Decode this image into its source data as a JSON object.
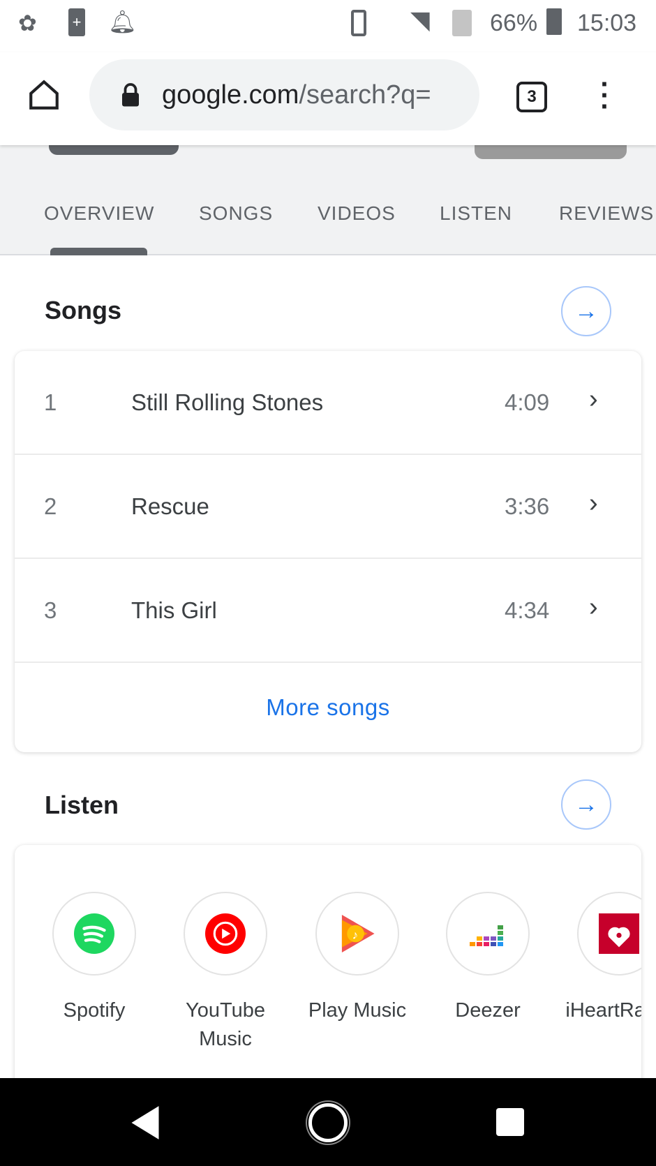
{
  "status_bar": {
    "battery": "66%",
    "time": "15:03",
    "icons": [
      "tree-icon",
      "battery-saver-icon",
      "bell-icon",
      "vibrate-icon",
      "wifi-icon",
      "no-sim-icon",
      "battery-icon"
    ]
  },
  "browser": {
    "url_domain": "google.com",
    "url_path": "/search?q=",
    "tab_count": "3"
  },
  "tabs": [
    {
      "label": "OVERVIEW",
      "active": true
    },
    {
      "label": "SONGS"
    },
    {
      "label": "VIDEOS"
    },
    {
      "label": "LISTEN"
    },
    {
      "label": "REVIEWS"
    }
  ],
  "songs": {
    "title": "Songs",
    "items": [
      {
        "num": "1",
        "title": "Still Rolling Stones",
        "duration": "4:09"
      },
      {
        "num": "2",
        "title": "Rescue",
        "duration": "3:36"
      },
      {
        "num": "3",
        "title": "This Girl",
        "duration": "4:34"
      }
    ],
    "more_label": "More songs"
  },
  "listen": {
    "title": "Listen",
    "services": [
      {
        "name": "Spotify",
        "color": "#1ed760"
      },
      {
        "name": "YouTube Music",
        "color": "#ff0000"
      },
      {
        "name": "Play Music",
        "color": "#ff8f00"
      },
      {
        "name": "Deezer",
        "color": "#ef5466"
      },
      {
        "name": "iHeartRadio",
        "color": "#c6002b"
      }
    ]
  },
  "accent": "#1a73e8"
}
